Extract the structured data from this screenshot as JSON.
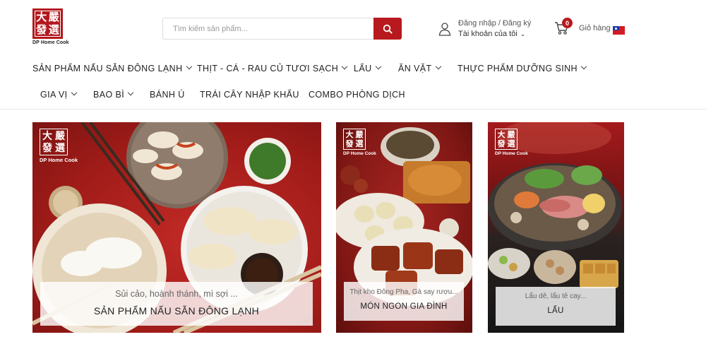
{
  "header": {
    "logo_text": "DP Home Cook",
    "logo_chars": [
      "大",
      "嚴",
      "發",
      "選"
    ],
    "search_placeholder": "Tìm kiếm sản phẩm...",
    "login_label": "Đăng nhập / Đăng ký",
    "account_label": "Tài khoản của tôi",
    "cart_count": "0",
    "cart_label": "Giỏ hàng"
  },
  "nav": {
    "items": [
      {
        "label": "SẢN PHẨM NẤU SẴN ĐÔNG LẠNH",
        "dropdown": true
      },
      {
        "label": "THỊT - CÁ - RAU CỦ TƯƠI SẠCH",
        "dropdown": true
      },
      {
        "label": "LẨU",
        "dropdown": true
      },
      {
        "label": "ĂN VẶT",
        "dropdown": true
      },
      {
        "label": "THỰC PHẨM DƯỠNG SINH",
        "dropdown": true
      },
      {
        "label": "GIA VỊ",
        "dropdown": true
      },
      {
        "label": "BAO BÌ",
        "dropdown": true
      },
      {
        "label": "BÁNH Ú",
        "dropdown": false
      },
      {
        "label": "TRÁI CÂY NHẬP KHẨU",
        "dropdown": false
      },
      {
        "label": "COMBO PHÒNG DỊCH",
        "dropdown": false
      }
    ]
  },
  "banners": [
    {
      "subtitle": "Sủi cảo, hoành thánh, mì sợi ...",
      "title": "SẢN PHẨM NẤU SẴN ĐÔNG LẠNH"
    },
    {
      "subtitle": "Thịt kho Đông Pha, Gà say rượu...",
      "title": "MÓN NGON GIA ĐÌNH"
    },
    {
      "subtitle": "Lẩu dê, lẩu tê cay...",
      "title": "LẨU"
    }
  ],
  "colors": {
    "brand_red": "#b8191e",
    "text": "#222222"
  }
}
